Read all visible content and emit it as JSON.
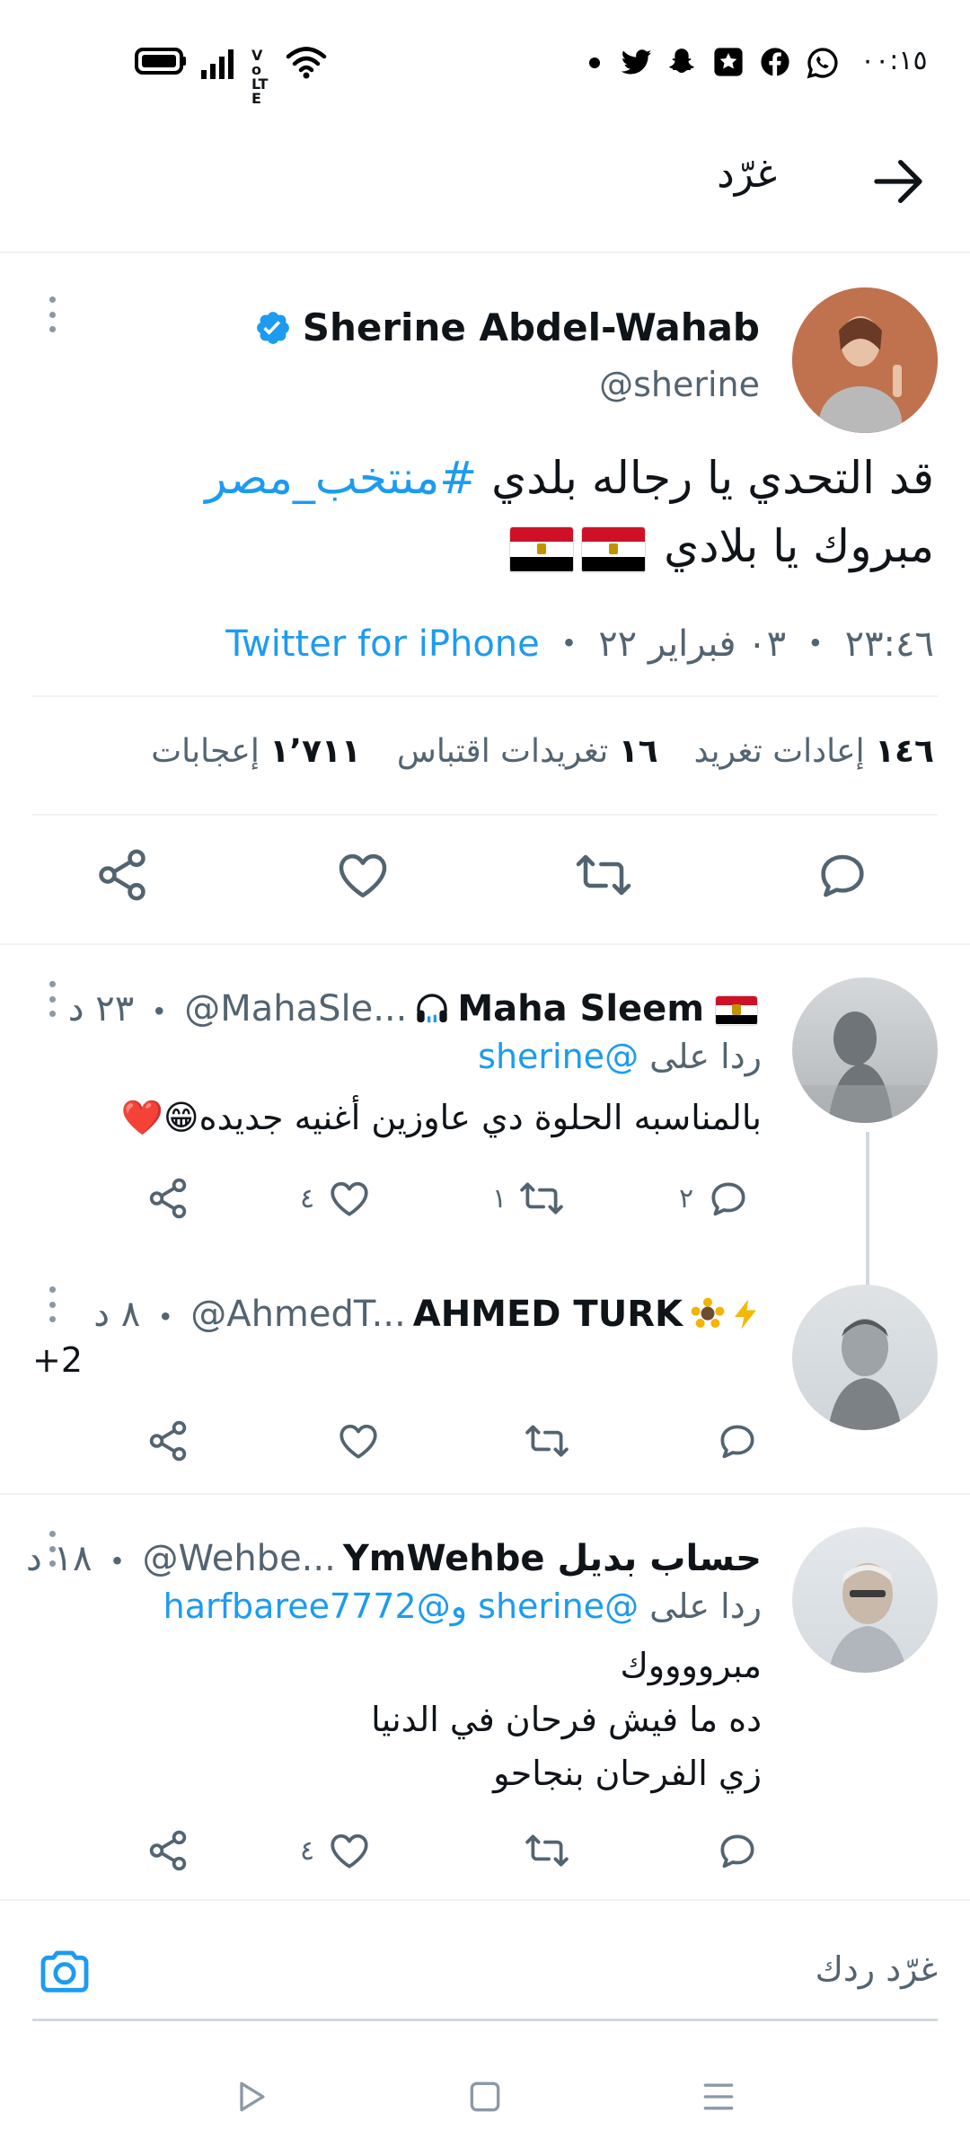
{
  "status_bar": {
    "time": "٠٠:١٥",
    "notification_icons": [
      "whatsapp-icon",
      "facebook-icon",
      "app-icon",
      "snapchat-icon",
      "twitter-icon",
      "dot-icon"
    ],
    "system_icons": [
      "wifi-icon",
      "volte-icon",
      "signal-icon",
      "battery-icon"
    ],
    "volte_label": "Vo LTE"
  },
  "header": {
    "title": "غرّد"
  },
  "main_tweet": {
    "author_name": "Sherine Abdel-Wahab",
    "handle": "@sherine",
    "text_line1_prefix": "قد التحدي يا رجاله بلدي",
    "hashtag": "#منتخب_مصر",
    "text_line2": "مبروك يا بلادي",
    "flags": [
      "🇪🇬",
      "🇪🇬"
    ],
    "timestamp": "٢٣:٤٦ ・ ٠٣ فبراير ٢٢",
    "separator": " ・ ",
    "source": "Twitter for iPhone",
    "stats": [
      {
        "count": "١٤٦",
        "label": "إعادات تغريد"
      },
      {
        "count": "١٦",
        "label": "تغريدات اقتباس"
      },
      {
        "count": "١٬٧١١",
        "label": "إعجابات"
      }
    ]
  },
  "replies": [
    {
      "author_name": "Maha Sleem",
      "name_prefix_emoji": "🇪🇬",
      "name_suffix_emoji": "🎧",
      "handle": "@MahaSle...",
      "time": "٢٣ د",
      "replying_prefix": "ردا على",
      "replying_to": "@sherine",
      "body_lines": [
        "بالمناسبه الحلوة دي عاوزين أغنيه جديده😁❤️"
      ],
      "reply_count": "٢",
      "retweet_count": "١",
      "like_count": "٤"
    },
    {
      "author_name": "AHMED TURK",
      "name_emojis": "🌻⚡",
      "handle": "@AhmedT...",
      "time": "٨ د",
      "body_lines": [
        "+2"
      ],
      "reply_count": "",
      "retweet_count": "",
      "like_count": ""
    },
    {
      "author_name": "حساب بديل YmWehbe",
      "handle": "@Wehbe...",
      "time": "١٨ د",
      "replying_prefix": "ردا على",
      "replying_to": "@sherine",
      "replying_and": "و",
      "replying_to_2": "@harfbaree7772",
      "body_lines": [
        "مبرووووك",
        "ده ما فيش فرحان في الدنيا",
        "زي الفرحان بنجاحو"
      ],
      "reply_count": "",
      "retweet_count": "",
      "like_count": "٤"
    }
  ],
  "compose": {
    "placeholder": "غرّد ردك"
  },
  "colors": {
    "accent": "#1d9bf0",
    "text": "#0f1419",
    "muted": "#536471",
    "divider": "#eff3f4"
  }
}
